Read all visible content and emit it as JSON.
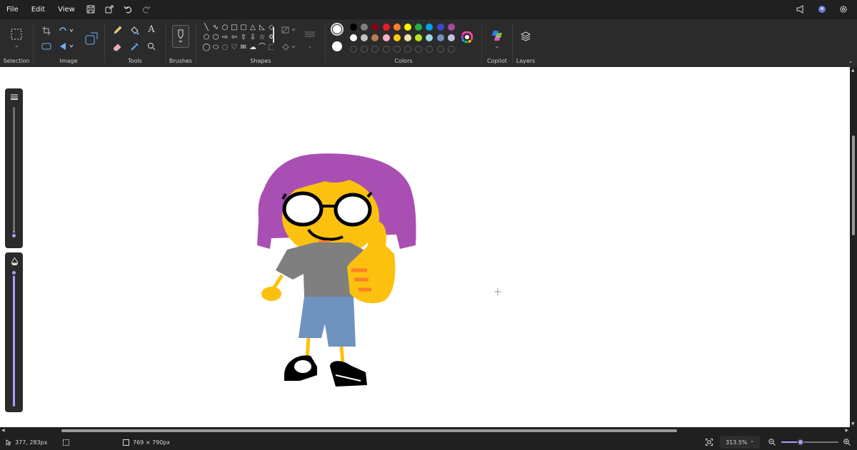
{
  "menu": {
    "file": "File",
    "edit": "Edit",
    "view": "View"
  },
  "ribbon": {
    "groups": {
      "selection": "Selection",
      "image": "Image",
      "tools": "Tools",
      "brushes": "Brushes",
      "shapes": "Shapes",
      "colors": "Colors",
      "copilot": "Copilot",
      "layers": "Layers"
    },
    "tool_text_glyph": "A",
    "shapes": [
      "╲",
      "∿",
      "○",
      "□",
      "▢",
      "△",
      "◺",
      "◇",
      "⬠",
      "⬡",
      "⇨",
      "⇦",
      "⇧",
      "⇩",
      "☆",
      "✡",
      "◯",
      "⬭",
      "◌",
      "♡",
      "✉",
      "☁",
      "⌒",
      "⬚"
    ],
    "palette_row1": [
      "#000000",
      "#7f7f7f",
      "#880015",
      "#ed1c24",
      "#ff7f27",
      "#fff200",
      "#22b14c",
      "#00a2e8",
      "#3f48cc",
      "#a349a4"
    ],
    "palette_row2": [
      "#ffffff",
      "#c3c3c3",
      "#b97a57",
      "#ffaec9",
      "#ffc90e",
      "#efe4b0",
      "#b5e61d",
      "#99d9ea",
      "#7092be",
      "#c8bfe7"
    ],
    "primary_color": "#ffffff",
    "secondary_color": "#ffffff"
  },
  "status": {
    "cursor_position": "377, 283px",
    "canvas_size": "769 × 790px",
    "zoom": "313.5%"
  }
}
